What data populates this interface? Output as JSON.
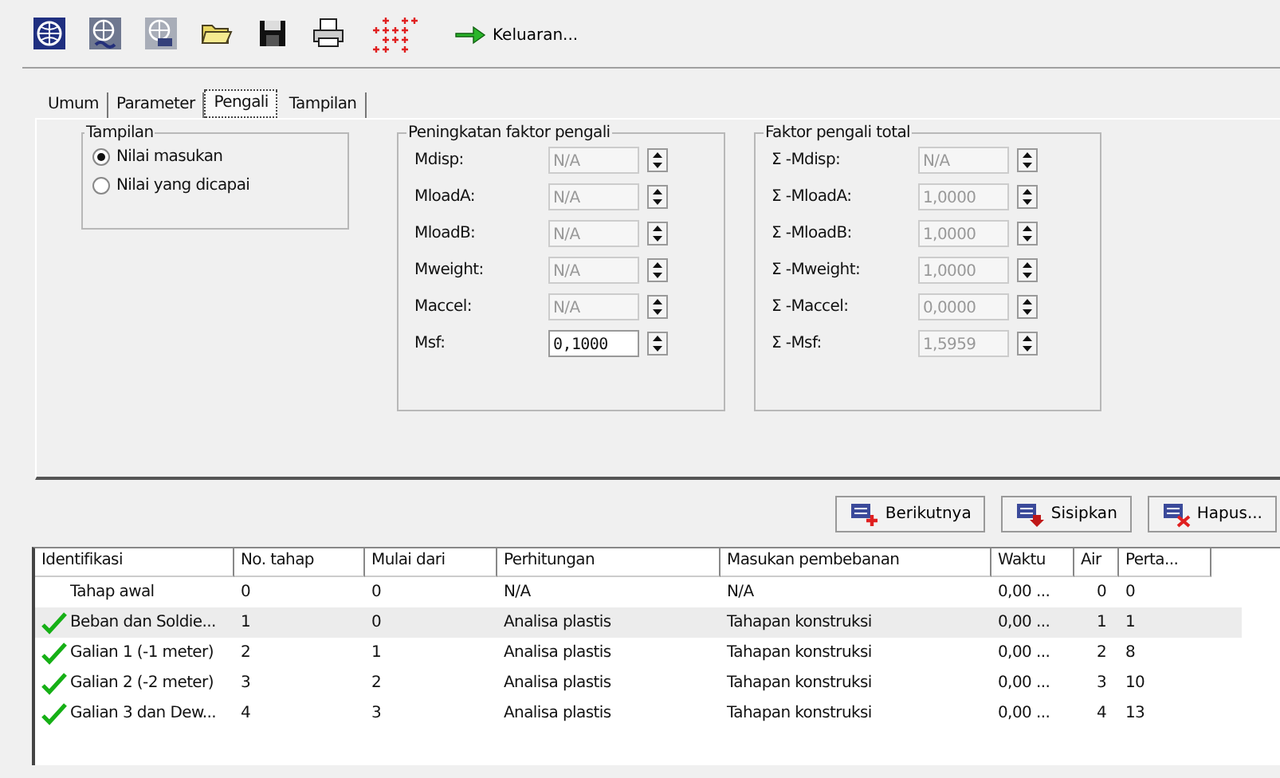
{
  "toolbar": {
    "tools": [
      {
        "kind": "globe"
      },
      {
        "kind": "globe-wave"
      },
      {
        "kind": "globe-grid"
      },
      {
        "kind": "open"
      },
      {
        "kind": "save"
      },
      {
        "kind": "print"
      },
      {
        "kind": "points"
      }
    ],
    "output_button": "Keluaran..."
  },
  "tabs": [
    {
      "label": "Umum",
      "selected": false
    },
    {
      "label": "Parameter",
      "selected": false
    },
    {
      "label": "Pengali",
      "selected": true
    },
    {
      "label": "Tampilan",
      "selected": false
    }
  ],
  "view_group": {
    "title": "Tampilan",
    "options": [
      {
        "label": "Nilai masukan",
        "selected": true
      },
      {
        "label": "Nilai yang dicapai",
        "selected": false
      }
    ]
  },
  "increment_group": {
    "title": "Peningkatan faktor pengali",
    "fields": [
      {
        "label": "Mdisp:",
        "value": "N/A",
        "disabled": true
      },
      {
        "label": "MloadA:",
        "value": "N/A",
        "disabled": true
      },
      {
        "label": "MloadB:",
        "value": "N/A",
        "disabled": true
      },
      {
        "label": "Mweight:",
        "value": "N/A",
        "disabled": true
      },
      {
        "label": "Maccel:",
        "value": "N/A",
        "disabled": true
      },
      {
        "label": "Msf:",
        "value": "0,1000",
        "disabled": false
      }
    ]
  },
  "total_group": {
    "title": "Faktor pengali total",
    "fields": [
      {
        "label": "Σ -Mdisp:",
        "value": "N/A",
        "disabled": true
      },
      {
        "label": "Σ -MloadA:",
        "value": "1,0000",
        "disabled": true
      },
      {
        "label": "Σ -MloadB:",
        "value": "1,0000",
        "disabled": true
      },
      {
        "label": "Σ -Mweight:",
        "value": "1,0000",
        "disabled": true
      },
      {
        "label": "Σ -Maccel:",
        "value": "0,0000",
        "disabled": true
      },
      {
        "label": "Σ -Msf:",
        "value": "1,5959",
        "disabled": true
      }
    ]
  },
  "phase_buttons": [
    {
      "kind": "add",
      "label": "Berikutnya"
    },
    {
      "kind": "insert",
      "label": "Sisipkan"
    },
    {
      "kind": "delete",
      "label": "Hapus..."
    }
  ],
  "table": {
    "columns": [
      "Identifikasi",
      "No. tahap",
      "Mulai dari",
      "Perhitungan",
      "Masukan pembebanan",
      "Waktu",
      "Air",
      "Perta..."
    ],
    "rows": [
      {
        "checked": false,
        "selected": false,
        "cells": [
          "Tahap awal",
          "0",
          "0",
          "N/A",
          "N/A",
          "0,00 ...",
          "0",
          "0"
        ]
      },
      {
        "checked": true,
        "selected": true,
        "cells": [
          "Beban dan Soldie...",
          "1",
          "0",
          "Analisa plastis",
          "Tahapan konstruksi",
          "0,00 ...",
          "1",
          "1"
        ]
      },
      {
        "checked": true,
        "selected": false,
        "cells": [
          "Galian 1 (-1 meter)",
          "2",
          "1",
          "Analisa plastis",
          "Tahapan konstruksi",
          "0,00 ...",
          "2",
          "8"
        ]
      },
      {
        "checked": true,
        "selected": false,
        "cells": [
          "Galian 2 (-2 meter)",
          "3",
          "2",
          "Analisa plastis",
          "Tahapan konstruksi",
          "0,00 ...",
          "3",
          "10"
        ]
      },
      {
        "checked": true,
        "selected": false,
        "cells": [
          "Galian 3 dan Dew...",
          "4",
          "3",
          "Analisa plastis",
          "Tahapan konstruksi",
          "0,00 ...",
          "4",
          "13"
        ]
      }
    ]
  }
}
